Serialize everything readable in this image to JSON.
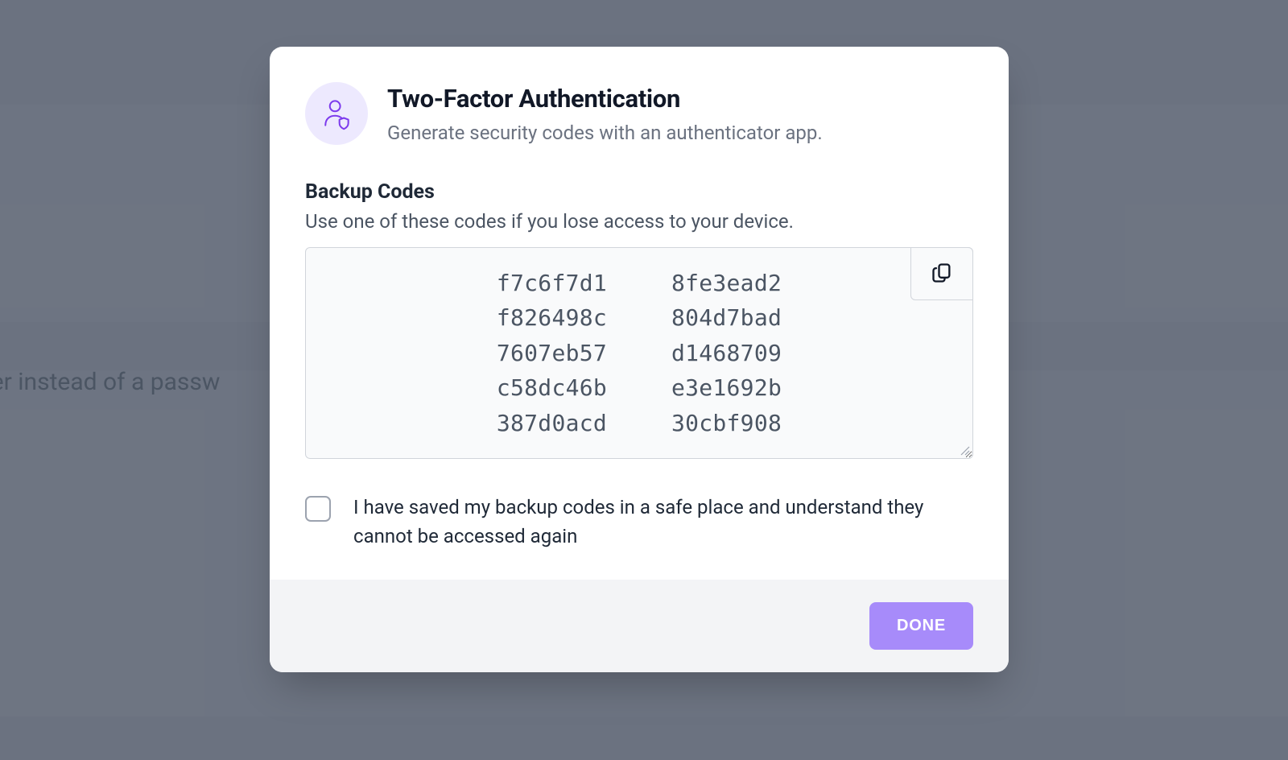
{
  "background": {
    "partial_text": "vider instead of a passw"
  },
  "modal": {
    "title": "Two-Factor Authentication",
    "subtitle": "Generate security codes with an authenticator app.",
    "section_title": "Backup Codes",
    "section_desc": "Use one of these codes if you lose access to your device.",
    "codes_left": [
      "f7c6f7d1",
      "f826498c",
      "7607eb57",
      "c58dc46b",
      "387d0acd"
    ],
    "codes_right": [
      "8fe3ead2",
      "804d7bad",
      "d1468709",
      "e3e1692b",
      "30cbf908"
    ],
    "checkbox_label": "I have saved my backup codes in a safe place and understand they cannot be accessed again",
    "done_label": "DONE"
  }
}
